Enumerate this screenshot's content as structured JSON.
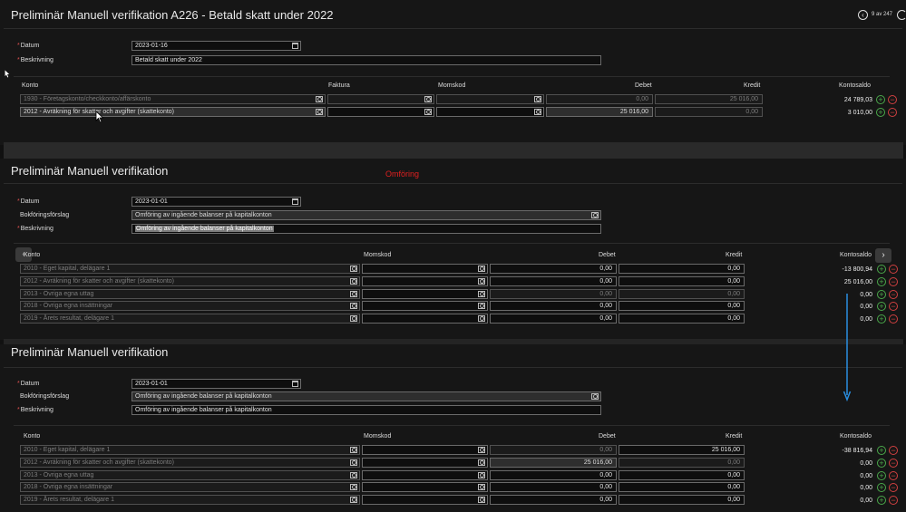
{
  "header": {
    "title": "Preliminär Manuell verifikation A226  -  Betald skatt under 2022",
    "pager": "9 av 247"
  },
  "section1": {
    "datum_label": "Datum",
    "datum_value": "2023-01-16",
    "beskrivning_label": "Beskrivning",
    "beskrivning_value": "Betald skatt under 2022",
    "columns": {
      "konto": "Konto",
      "faktura": "Faktura",
      "momskod": "Momskod",
      "debet": "Debet",
      "kredit": "Kredit",
      "kontosaldo": "Kontosaldo"
    },
    "rows": [
      {
        "konto": "1930 - Företagskonto/checkkonto/affärskonto",
        "debet": "0,00",
        "kredit": "25 016,00",
        "saldo": "24 789,03"
      },
      {
        "konto": "2012 - Avräkning för skatter och avgifter (skattekonto)",
        "debet": "25 016,00",
        "kredit": "0,00",
        "saldo": "3 010,00"
      }
    ]
  },
  "section2": {
    "title": "Preliminär Manuell verifikation",
    "annotation": "Omföring",
    "datum_label": "Datum",
    "datum_value": "2023-01-01",
    "bokforingsforslag_label": "Bokföringsförslag",
    "bokforingsforslag_value": "Omföring av ingående balanser på kapitalkonton",
    "beskrivning_label": "Beskrivning",
    "beskrivning_value": "Omföring av ingående balanser på kapitalkonton",
    "columns": {
      "konto": "Konto",
      "momskod": "Momskod",
      "debet": "Debet",
      "kredit": "Kredit",
      "kontosaldo": "Kontosaldo"
    },
    "rows": [
      {
        "konto": "2010 - Eget kapital, delägare 1",
        "debet": "0,00",
        "kredit": "0,00",
        "saldo": "-13 800,94"
      },
      {
        "konto": "2012 - Avräkning för skatter och avgifter (skattekonto)",
        "debet": "0,00",
        "kredit": "0,00",
        "saldo": "25 016,00"
      },
      {
        "konto": "2013 - Övriga egna uttag",
        "debet": "0,00",
        "kredit": "0,00",
        "saldo": "0,00"
      },
      {
        "konto": "2018 - Övriga egna insättningar",
        "debet": "0,00",
        "kredit": "0,00",
        "saldo": "0,00"
      },
      {
        "konto": "2019 - Årets resultat, delägare 1",
        "debet": "0,00",
        "kredit": "0,00",
        "saldo": "0,00"
      }
    ]
  },
  "section3": {
    "title": "Preliminär Manuell verifikation",
    "datum_label": "Datum",
    "datum_value": "2023-01-01",
    "bokforingsforslag_label": "Bokföringsförslag",
    "bokforingsforslag_value": "Omföring av ingående balanser på kapitalkonton",
    "beskrivning_label": "Beskrivning",
    "beskrivning_value": "Omföring av ingående balanser på kapitalkonton",
    "columns": {
      "konto": "Konto",
      "momskod": "Momskod",
      "debet": "Debet",
      "kredit": "Kredit",
      "kontosaldo": "Kontosaldo"
    },
    "rows": [
      {
        "konto": "2010 - Eget kapital, delägare 1",
        "debet": "0,00",
        "kredit": "25 016,00",
        "saldo": "-38 816,94"
      },
      {
        "konto": "2012 - Avräkning för skatter och avgifter (skattekonto)",
        "debet": "25 016,00",
        "kredit": "0,00",
        "saldo": "0,00"
      },
      {
        "konto": "2013 - Övriga egna uttag",
        "debet": "0,00",
        "kredit": "0,00",
        "saldo": "0,00"
      },
      {
        "konto": "2018 - Övriga egna insättningar",
        "debet": "0,00",
        "kredit": "0,00",
        "saldo": "0,00"
      },
      {
        "konto": "2019 - Årets resultat, delägare 1",
        "debet": "0,00",
        "kredit": "0,00",
        "saldo": "0,00"
      }
    ]
  },
  "colors": {
    "accent_plus": "#4aa84a",
    "accent_minus": "#d04040",
    "annotation_red": "#e02020",
    "arrow_blue": "#2a8ee0"
  }
}
